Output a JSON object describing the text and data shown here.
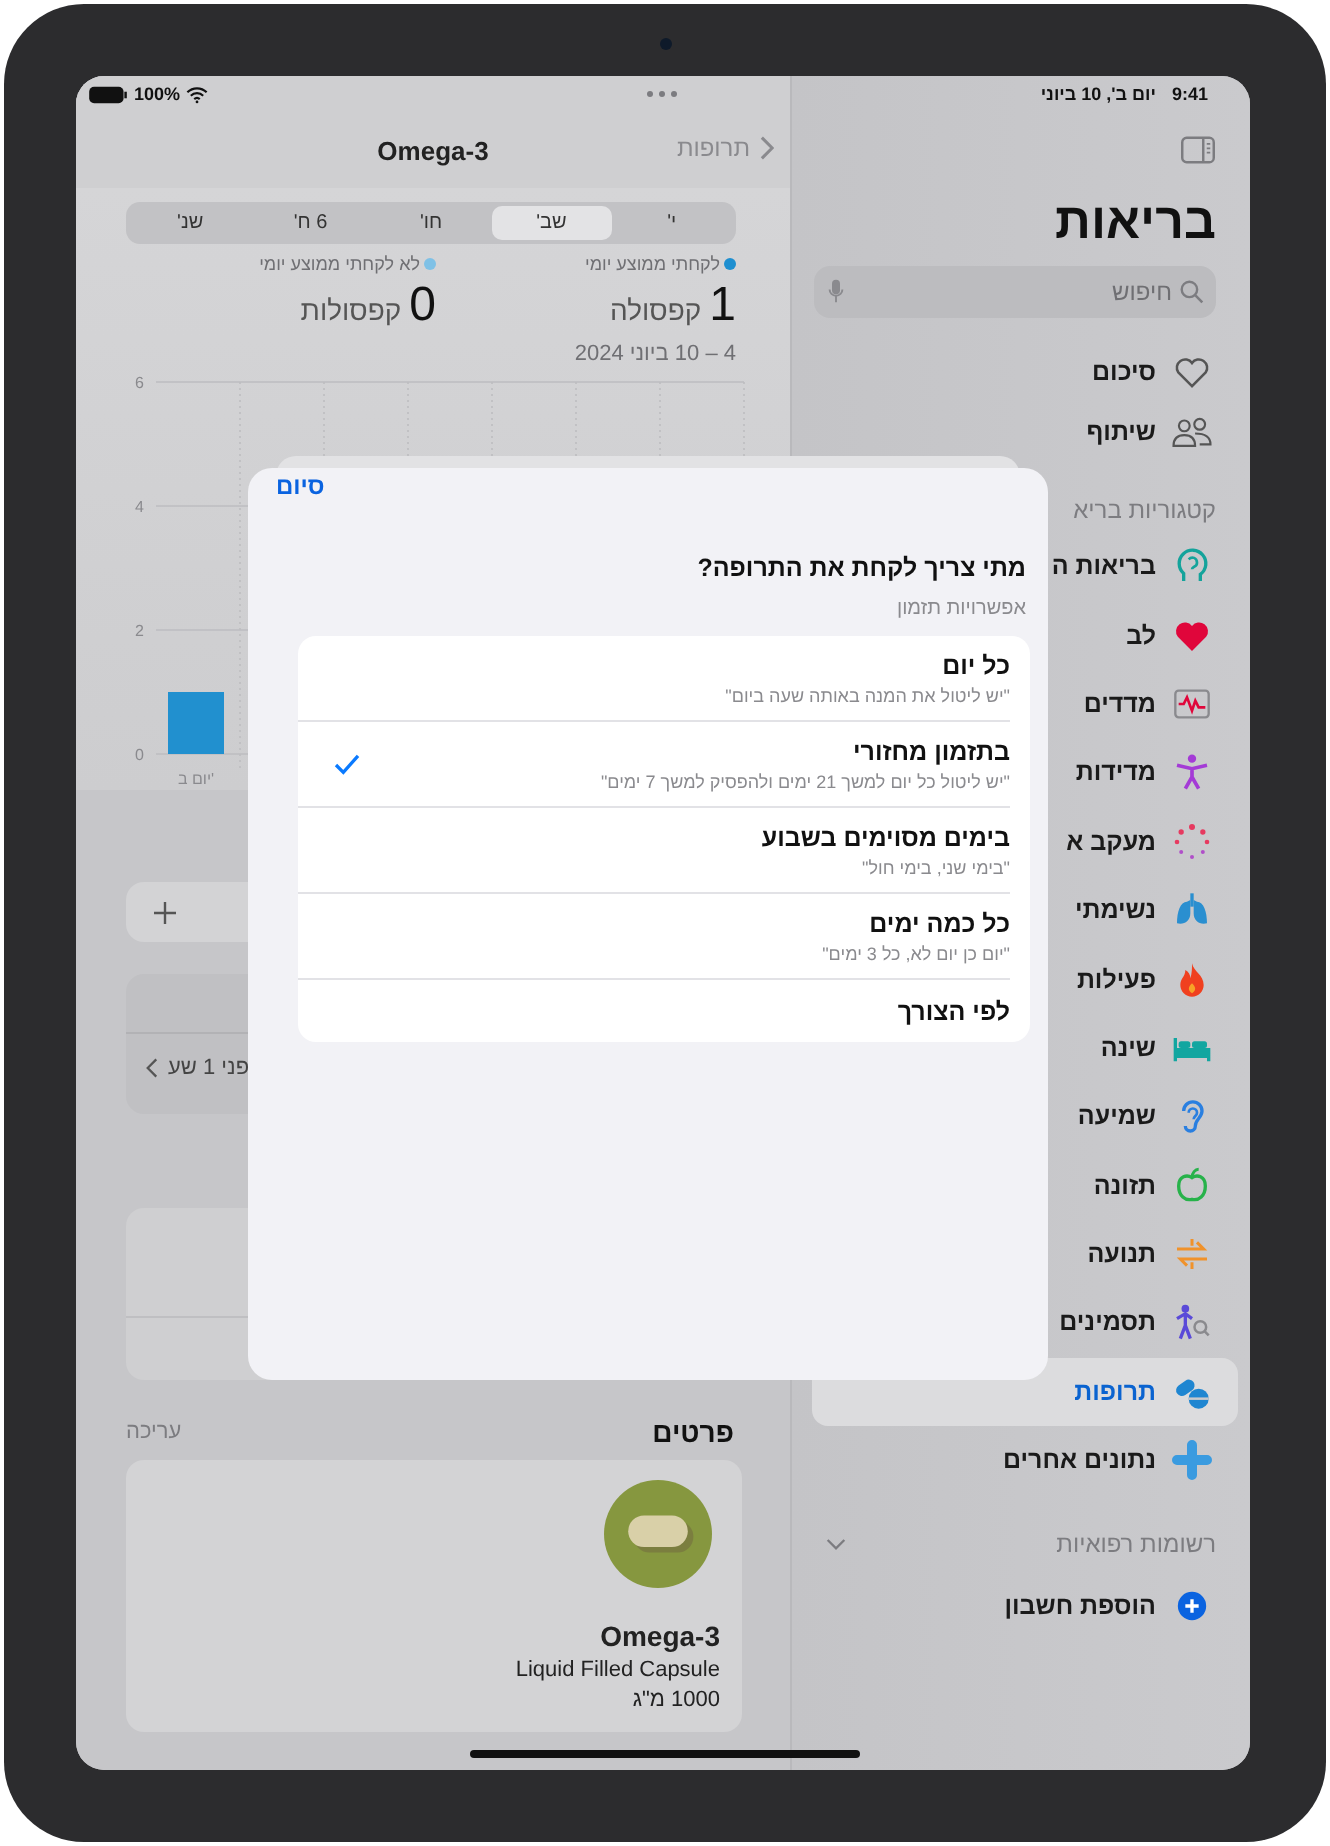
{
  "status_bar": {
    "battery": "100%",
    "time": "9:41",
    "date": "יום ב', 10 ביוני"
  },
  "detail": {
    "back": "תרופות",
    "title": "Omega-3",
    "ranges": [
      {
        "label": "י'",
        "selected": false
      },
      {
        "label": "שב'",
        "selected": true
      },
      {
        "label": "חו'",
        "selected": false
      },
      {
        "label": "6 ח'",
        "selected": false
      },
      {
        "label": "שנ'",
        "selected": false
      }
    ],
    "legend": [
      {
        "label": "לקחתי ממוצע יומי",
        "value": "1",
        "unit": "קפסולה",
        "color": "#1e8fd0"
      },
      {
        "label": "לא לקחתי ממוצע יומי",
        "value": "0",
        "unit": "קפסולות",
        "color": "#7fc1e6"
      }
    ],
    "date_range": "4 – 10 ביוני 2024",
    "chart_data": {
      "type": "bar",
      "categories": [
        "יום ב'"
      ],
      "values": [
        1
      ],
      "ylim": [
        0,
        6
      ],
      "yticks": [
        0,
        2,
        4,
        6
      ]
    },
    "log_time": "פני 1 שע'",
    "details_title": "פרטים",
    "edit": "עריכה",
    "medication": {
      "name": "Omega-3",
      "form": "Liquid Filled Capsule",
      "strength": "1000 מ\"ג"
    }
  },
  "sidebar": {
    "title": "בריאות",
    "search": {
      "placeholder": "חיפוש"
    },
    "items": [
      {
        "label": "סיכום",
        "selected": false
      },
      {
        "label": "שיתוף",
        "selected": false
      }
    ],
    "section_title": "קטגוריות בריא",
    "categories": [
      {
        "label": "בריאות ה",
        "selected": false
      },
      {
        "label": "לב",
        "selected": false
      },
      {
        "label": "מדדים",
        "selected": false
      },
      {
        "label": "מדידות",
        "selected": false
      },
      {
        "label": "מעקב א",
        "selected": false
      },
      {
        "label": "נשימתי",
        "selected": false
      },
      {
        "label": "פעילות",
        "selected": false
      },
      {
        "label": "שינה",
        "selected": false
      },
      {
        "label": "שמיעה",
        "selected": false
      },
      {
        "label": "תזונה",
        "selected": false
      },
      {
        "label": "תנועה",
        "selected": false
      },
      {
        "label": "תסמינים",
        "selected": false
      },
      {
        "label": "תרופות",
        "selected": true
      },
      {
        "label": "נתונים אחרים",
        "selected": false
      }
    ],
    "records_title": "רשומות רפואיות",
    "add_account": "הוספת חשבון"
  },
  "modal": {
    "done": "סיום",
    "question": "מתי צריך לקחת את התרופה?",
    "section": "אפשרויות תזמון",
    "options": [
      {
        "title": "כל יום",
        "subtitle": "\"יש ליטול את המנה באותה שעה ביום\"",
        "selected": false
      },
      {
        "title": "בתזמון מחזורי",
        "subtitle": "\"יש ליטול כל יום למשך 21 ימים ולהפסיק למשך 7 ימים\"",
        "selected": true
      },
      {
        "title": "בימים מסוימים בשבוע",
        "subtitle": "\"בימי שני, בימי חול\"",
        "selected": false
      },
      {
        "title": "כל כמה ימים",
        "subtitle": "\"יום כן יום לא, כל 3 ימים\"",
        "selected": false
      },
      {
        "title": "לפי הצורך",
        "selected": false
      }
    ]
  }
}
